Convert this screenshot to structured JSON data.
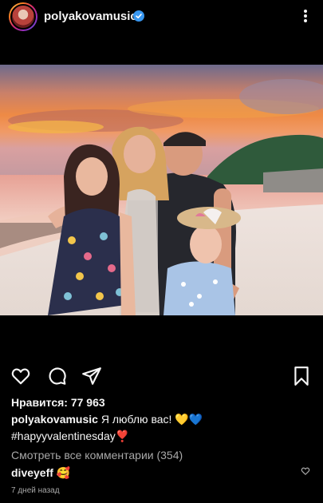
{
  "post": {
    "username": "polyakovamusic",
    "verified_icon": "verified-badge-icon",
    "more_icon": "more-vertical-icon",
    "likes_label": "Нравится: 77 963",
    "caption_username": "polyakovamusic",
    "caption_text": "Я люблю вас! 💛💙",
    "hashtag": "#hapyyvalentinesday❣️",
    "view_comments": "Смотреть все комментарии (354)",
    "comment_user": "diveyeff",
    "comment_text": "🥰",
    "timestamp": "7 дней назад"
  },
  "icons": {
    "like": "heart-icon",
    "comment": "comment-icon",
    "share": "send-icon",
    "save": "bookmark-icon"
  },
  "colors": {
    "background": "#000000",
    "text": "#f5f5f5",
    "muted": "#a8a8a8",
    "verified": "#3897f0"
  }
}
